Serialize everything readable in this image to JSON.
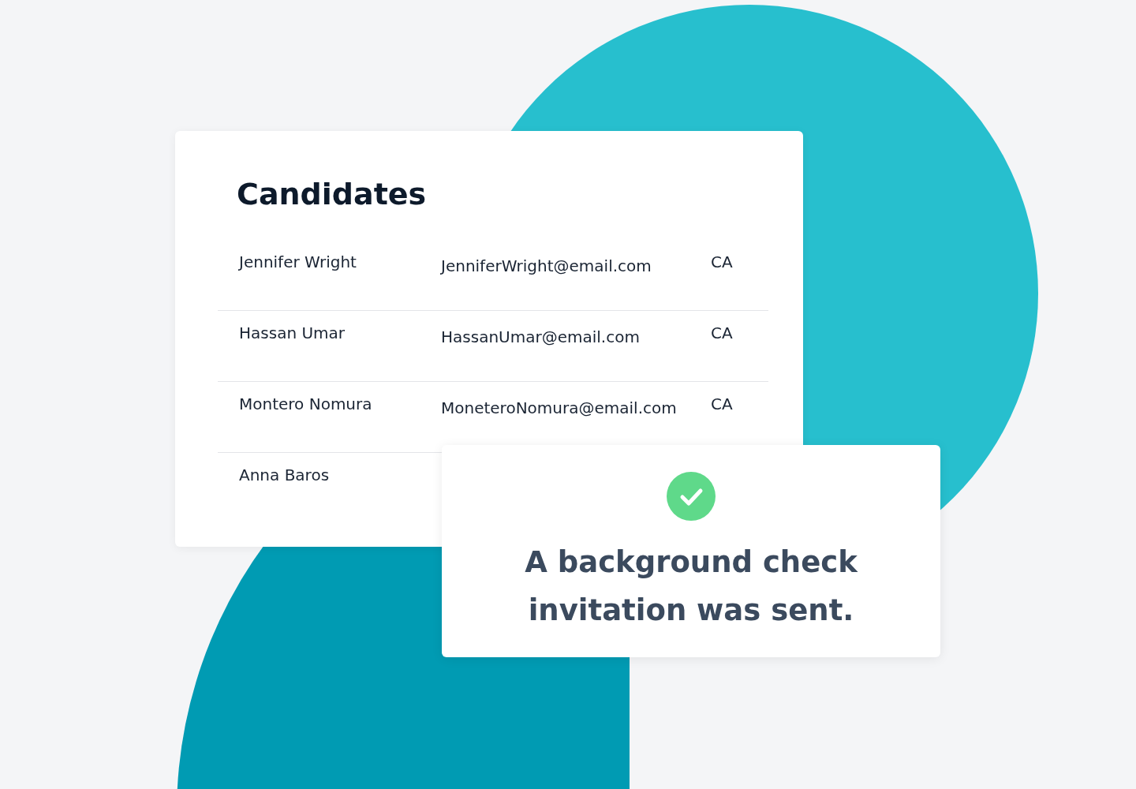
{
  "candidates_card": {
    "title": "Candidates",
    "rows": [
      {
        "name": "Jennifer Wright",
        "email": "JenniferWright@email.com",
        "region": "CA"
      },
      {
        "name": "Hassan Umar",
        "email": "HassanUmar@email.com",
        "region": "CA"
      },
      {
        "name": "Montero Nomura",
        "email": "MoneteroNomura@email.com",
        "region": "CA"
      },
      {
        "name": "Anna Baros"
      }
    ]
  },
  "notification": {
    "message": "A background check invitation was sent."
  }
}
